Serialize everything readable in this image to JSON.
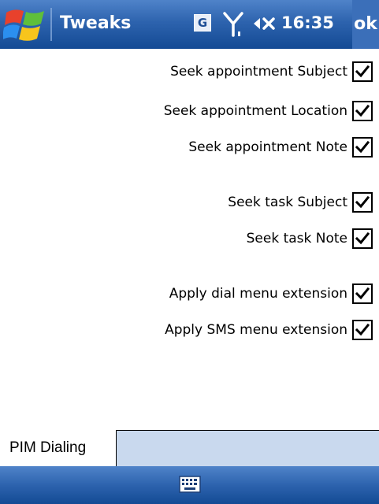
{
  "titlebar": {
    "title": "Tweaks",
    "clock": "16:35",
    "ok_label": "ok",
    "g_label": "G"
  },
  "options": [
    {
      "label": "Seek appointment Subject",
      "checked": true
    },
    {
      "label": "Seek appointment Location",
      "checked": true
    },
    {
      "label": "Seek appointment Note",
      "checked": true
    },
    {
      "label": "Seek task Subject",
      "checked": true
    },
    {
      "label": "Seek task Note",
      "checked": true
    },
    {
      "label": "Apply dial menu extension",
      "checked": true
    },
    {
      "label": "Apply SMS menu extension",
      "checked": true
    }
  ],
  "tabs": [
    {
      "label": "PIM Dialing",
      "active": true
    }
  ],
  "icons": {
    "start": "windows-flag-icon",
    "connectivity": "g-icon",
    "signal": "signal-antenna-icon",
    "volume": "volume-muted-icon",
    "input": "keyboard-icon"
  },
  "colors": {
    "titlebar": "#2d63ae",
    "tab_strip": "#c9d9ee"
  }
}
